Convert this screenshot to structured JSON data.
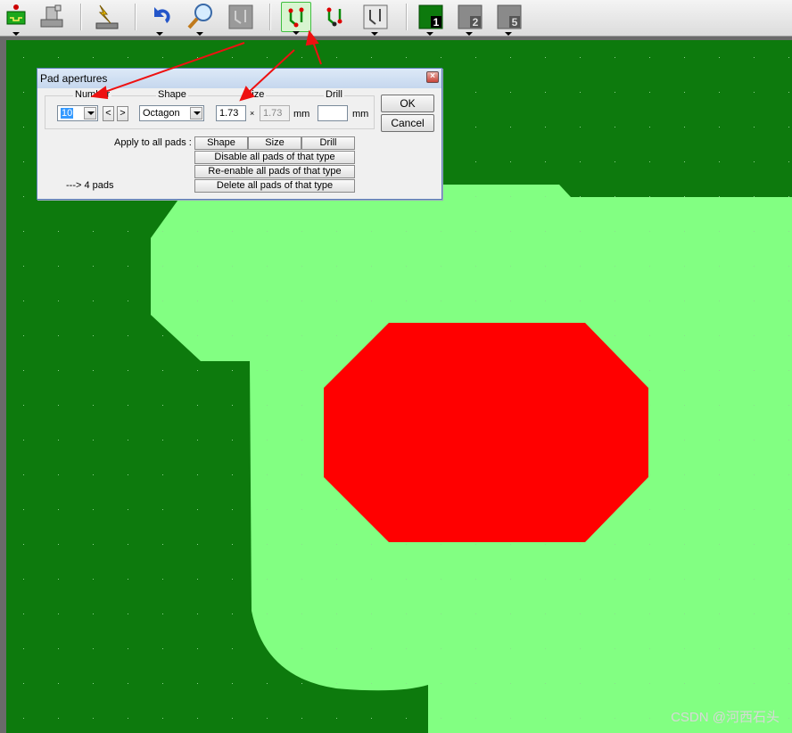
{
  "toolbar": {
    "buttons": [
      {
        "icon": "board-properties-icon"
      },
      {
        "icon": "solder-iron-icon"
      },
      {
        "icon": "autoroute-flash-icon"
      },
      {
        "icon": "undo-icon"
      },
      {
        "icon": "zoom-icon"
      },
      {
        "icon": "pcb-track-icon"
      },
      {
        "icon": "pcb-track-active-icon"
      },
      {
        "icon": "pcb-track-red-icon"
      },
      {
        "icon": "pcb-track-gray-icon"
      },
      {
        "icon": "layer-1-icon",
        "number": "1"
      },
      {
        "icon": "layer-2-icon",
        "number": "2"
      },
      {
        "icon": "layer-5-icon",
        "number": "5"
      }
    ]
  },
  "dialog": {
    "title": "Pad apertures",
    "close_label": "×",
    "group_labels": {
      "number": "Number",
      "shape": "Shape",
      "size": "Size",
      "drill": "Drill"
    },
    "number_value": "10",
    "prev_label": "<",
    "next_label": ">",
    "shape_value": "Octagon",
    "size_value": "1.73",
    "times_sign": "×",
    "size2_value": "1.73",
    "size_unit": "mm",
    "drill_value": "",
    "drill_unit": "mm",
    "ok_label": "OK",
    "cancel_label": "Cancel",
    "apply_label": "Apply to all pads :",
    "shape_btn": "Shape",
    "size_btn": "Size",
    "drill_btn": "Drill",
    "disable_btn": "Disable all pads of that type",
    "reenable_btn": "Re-enable all pads of that type",
    "delete_btn": "Delete all pads of that type",
    "pads_count": "---> 4 pads"
  },
  "colors": {
    "board": "#0d7a0d",
    "copper": "#82ff82",
    "pad": "#ff0000",
    "annotation_arrow": "#ee1111"
  },
  "watermark": "CSDN @河西石头"
}
